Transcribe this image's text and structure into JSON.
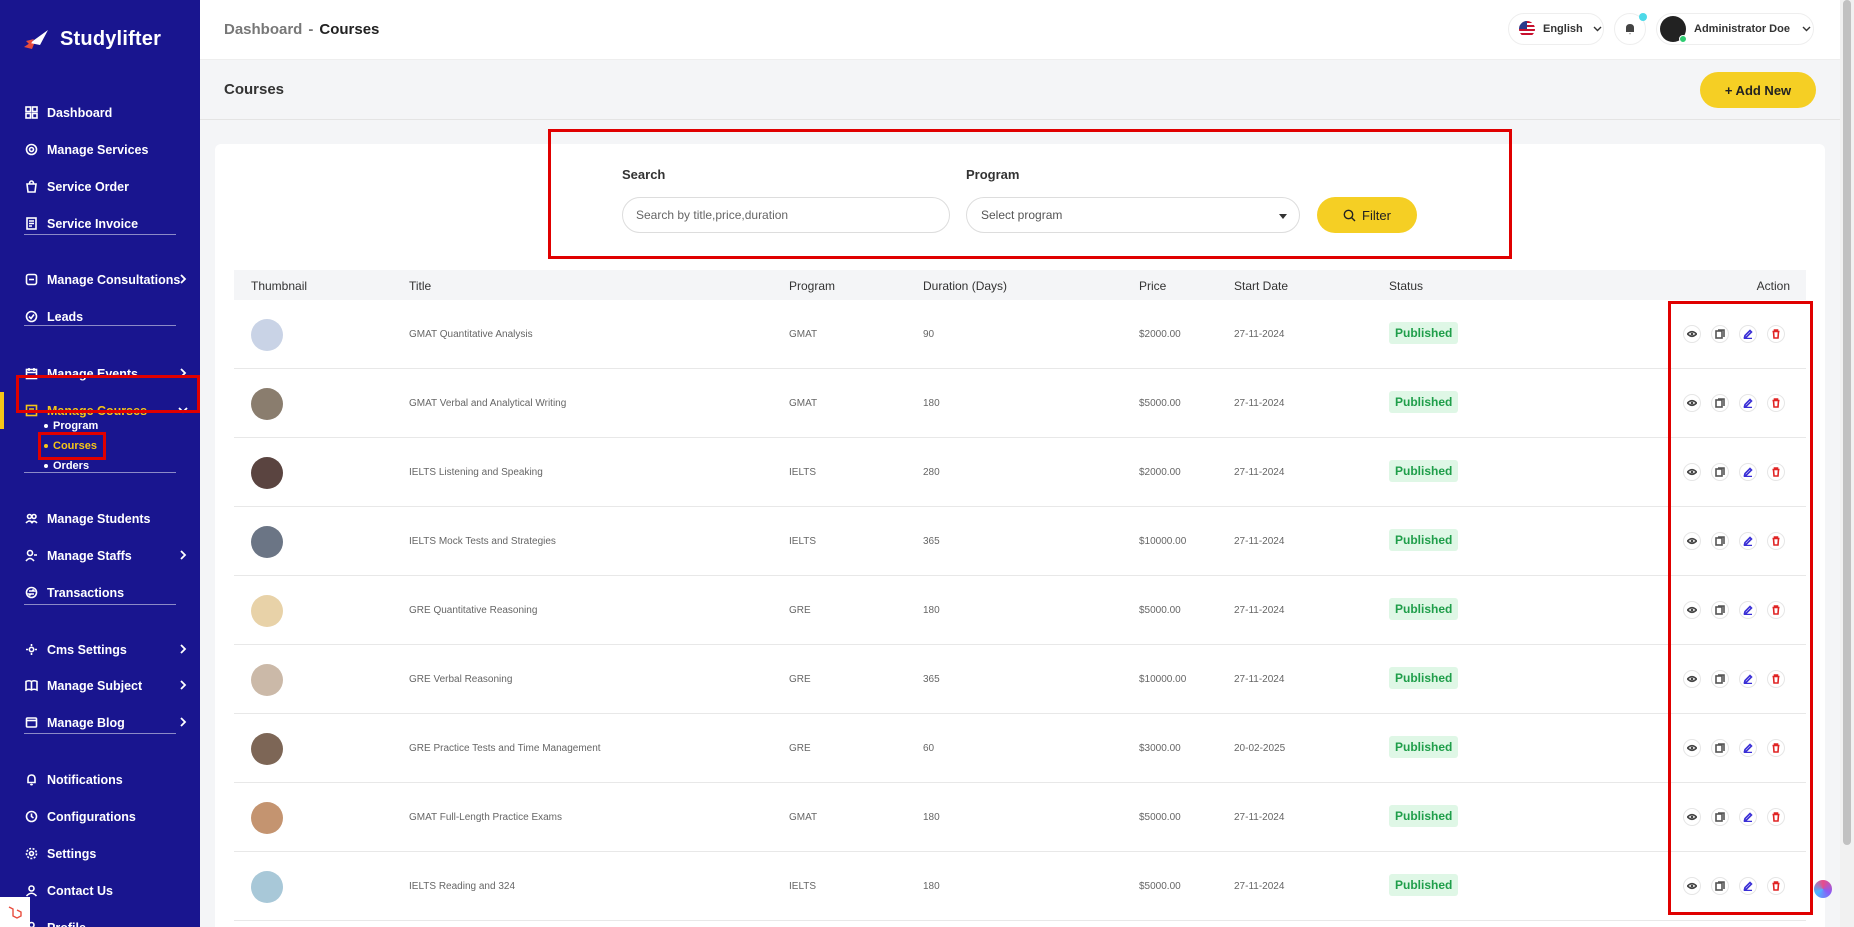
{
  "brand": {
    "name": "Studylifter"
  },
  "sidebar": {
    "items": [
      {
        "label": "Dashboard",
        "icon": "grid-icon",
        "chevron": false
      },
      {
        "label": "Manage Services",
        "icon": "services-icon",
        "chevron": false
      },
      {
        "label": "Service Order",
        "icon": "order-icon",
        "chevron": false
      },
      {
        "label": "Service Invoice",
        "icon": "invoice-icon",
        "chevron": false
      },
      {
        "label": "Manage Consultations",
        "icon": "consultation-icon",
        "chevron": true
      },
      {
        "label": "Leads",
        "icon": "leads-icon",
        "chevron": false
      },
      {
        "label": "Manage Events",
        "icon": "calendar-icon",
        "chevron": true
      },
      {
        "label": "Manage Courses",
        "icon": "courses-icon",
        "chevron": true,
        "active": true
      },
      {
        "label": "Manage Students",
        "icon": "students-icon",
        "chevron": false
      },
      {
        "label": "Manage Staffs",
        "icon": "staffs-icon",
        "chevron": true
      },
      {
        "label": "Transactions",
        "icon": "transactions-icon",
        "chevron": false
      },
      {
        "label": "Cms Settings",
        "icon": "cms-icon",
        "chevron": true
      },
      {
        "label": "Manage Subject",
        "icon": "subject-icon",
        "chevron": true
      },
      {
        "label": "Manage Blog",
        "icon": "blog-icon",
        "chevron": true
      },
      {
        "label": "Notifications",
        "icon": "bell-icon",
        "chevron": false
      },
      {
        "label": "Configurations",
        "icon": "config-icon",
        "chevron": false
      },
      {
        "label": "Settings",
        "icon": "gear-icon",
        "chevron": false
      },
      {
        "label": "Contact Us",
        "icon": "contact-icon",
        "chevron": false
      },
      {
        "label": "Profile",
        "icon": "profile-icon",
        "chevron": false
      }
    ],
    "submenu": [
      {
        "label": "Program"
      },
      {
        "label": "Courses",
        "active": true
      },
      {
        "label": "Orders"
      }
    ]
  },
  "topbar": {
    "breadcrumb_root": "Dashboard",
    "breadcrumb_sep": "-",
    "breadcrumb_current": "Courses",
    "language": "English",
    "user_name": "Administrator Doe"
  },
  "page": {
    "title": "Courses",
    "add_button": "+ Add New"
  },
  "filter": {
    "search_label": "Search",
    "search_placeholder": "Search by title,price,duration",
    "program_label": "Program",
    "program_placeholder": "Select program",
    "filter_button": "Filter"
  },
  "table": {
    "headers": {
      "thumbnail": "Thumbnail",
      "title": "Title",
      "program": "Program",
      "duration": "Duration (Days)",
      "price": "Price",
      "start_date": "Start Date",
      "status": "Status",
      "action": "Action"
    },
    "rows": [
      {
        "title": "GMAT Quantitative Analysis",
        "program": "GMAT",
        "duration": "90",
        "price": "$2000.00",
        "start_date": "27-11-2024",
        "status": "Published",
        "thumb_color": "#c9d3e6"
      },
      {
        "title": "GMAT Verbal and Analytical Writing",
        "program": "GMAT",
        "duration": "180",
        "price": "$5000.00",
        "start_date": "27-11-2024",
        "status": "Published",
        "thumb_color": "#8a7d6e"
      },
      {
        "title": "IELTS Listening and Speaking",
        "program": "IELTS",
        "duration": "280",
        "price": "$2000.00",
        "start_date": "27-11-2024",
        "status": "Published",
        "thumb_color": "#5a4440"
      },
      {
        "title": "IELTS Mock Tests and Strategies",
        "program": "IELTS",
        "duration": "365",
        "price": "$10000.00",
        "start_date": "27-11-2024",
        "status": "Published",
        "thumb_color": "#6b7585"
      },
      {
        "title": "GRE Quantitative Reasoning",
        "program": "GRE",
        "duration": "180",
        "price": "$5000.00",
        "start_date": "27-11-2024",
        "status": "Published",
        "thumb_color": "#e8d2a8"
      },
      {
        "title": "GRE Verbal Reasoning",
        "program": "GRE",
        "duration": "365",
        "price": "$10000.00",
        "start_date": "27-11-2024",
        "status": "Published",
        "thumb_color": "#cbb9a8"
      },
      {
        "title": "GRE Practice Tests and Time Management",
        "program": "GRE",
        "duration": "60",
        "price": "$3000.00",
        "start_date": "20-02-2025",
        "status": "Published",
        "thumb_color": "#7d6656"
      },
      {
        "title": "GMAT Full-Length Practice Exams",
        "program": "GMAT",
        "duration": "180",
        "price": "$5000.00",
        "start_date": "27-11-2024",
        "status": "Published",
        "thumb_color": "#c49470"
      },
      {
        "title": "IELTS Reading and 324",
        "program": "IELTS",
        "duration": "180",
        "price": "$5000.00",
        "start_date": "27-11-2024",
        "status": "Published",
        "thumb_color": "#a8c8d8"
      }
    ]
  },
  "colors": {
    "sidebar_bg": "#19158f",
    "accent_yellow": "#f5cf24",
    "status_green": "#1f9e4a",
    "highlight_red": "#e00000"
  }
}
